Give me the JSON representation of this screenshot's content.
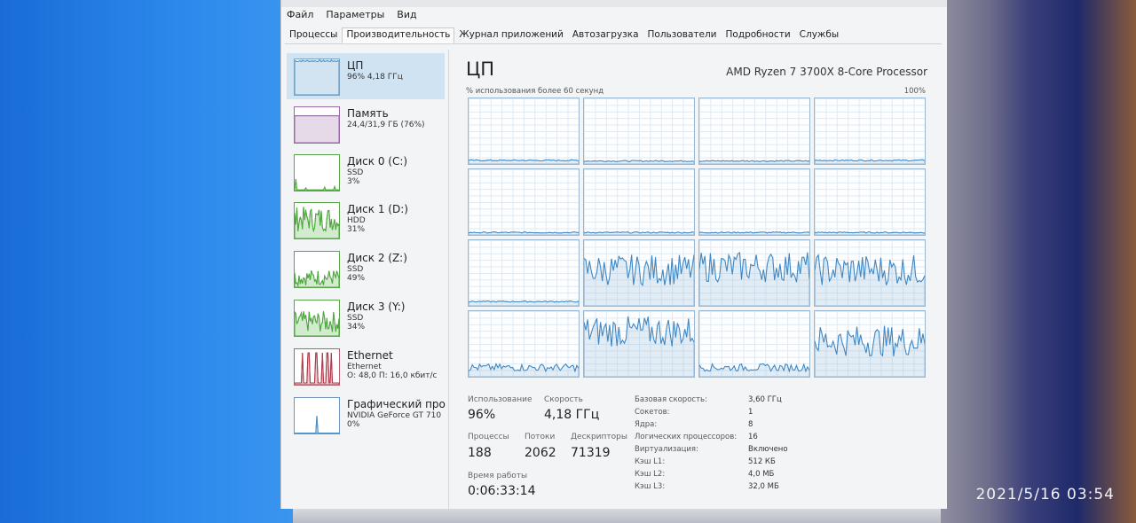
{
  "menu": [
    "Файл",
    "Параметры",
    "Вид"
  ],
  "tabs": [
    {
      "label": "Процессы",
      "active": false
    },
    {
      "label": "Производительность",
      "active": true
    },
    {
      "label": "Журнал приложений",
      "active": false
    },
    {
      "label": "Автозагрузка",
      "active": false
    },
    {
      "label": "Пользователи",
      "active": false
    },
    {
      "label": "Подробности",
      "active": false
    },
    {
      "label": "Службы",
      "active": false
    }
  ],
  "sidebar": [
    {
      "title": "ЦП",
      "line1": "96% 4,18 ГГц",
      "line2": "",
      "kind": "cpu",
      "active": true
    },
    {
      "title": "Память",
      "line1": "24,4/31,9 ГБ (76%)",
      "line2": "",
      "kind": "mem",
      "active": false
    },
    {
      "title": "Диск 0 (C:)",
      "line1": "SSD",
      "line2": "3%",
      "kind": "disk",
      "active": false
    },
    {
      "title": "Диск 1 (D:)",
      "line1": "HDD",
      "line2": "31%",
      "kind": "disk",
      "active": false
    },
    {
      "title": "Диск 2 (Z:)",
      "line1": "SSD",
      "line2": "49%",
      "kind": "disk",
      "active": false
    },
    {
      "title": "Диск 3 (Y:)",
      "line1": "SSD",
      "line2": "34%",
      "kind": "disk",
      "active": false
    },
    {
      "title": "Ethernet",
      "line1": "Ethernet",
      "line2": "О: 48,0 П: 16,0 кбит/с",
      "kind": "eth",
      "active": false
    },
    {
      "title": "Графический про",
      "line1": "NVIDIA GeForce GT 710",
      "line2": "0%",
      "kind": "gpu",
      "active": false
    }
  ],
  "main": {
    "title": "ЦП",
    "processor": "AMD Ryzen 7 3700X 8-Core Processor",
    "graph_caption": "% использования более 60 секунд",
    "graph_max": "100%",
    "core_activity": [
      0.02,
      0.01,
      0.01,
      0.02,
      0.0,
      0.0,
      0.0,
      0.0,
      0.03,
      0.55,
      0.6,
      0.55,
      0.12,
      0.7,
      0.12,
      0.55
    ]
  },
  "stats": {
    "usage_label": "Использование",
    "usage_value": "96%",
    "speed_label": "Скорость",
    "speed_value": "4,18 ГГц",
    "processes_label": "Процессы",
    "processes_value": "188",
    "threads_label": "Потоки",
    "threads_value": "2062",
    "handles_label": "Дескрипторы",
    "handles_value": "71319",
    "uptime_label": "Время работы",
    "uptime_value": "0:06:33:14"
  },
  "details": [
    {
      "label": "Базовая скорость:",
      "value": "3,60 ГГц"
    },
    {
      "label": "Сокетов:",
      "value": "1"
    },
    {
      "label": "Ядра:",
      "value": "8"
    },
    {
      "label": "Логических процессоров:",
      "value": "16"
    },
    {
      "label": "Виртуализация:",
      "value": "Включено"
    },
    {
      "label": "Кэш L1:",
      "value": "512 КБ"
    },
    {
      "label": "Кэш L2:",
      "value": "4,0 МБ"
    },
    {
      "label": "Кэш L3:",
      "value": "32,0 МБ"
    }
  ],
  "timestamp": "2021/5/16  03:54",
  "colors": {
    "cpu": "#4a90c8",
    "mem": "#9b6aa8",
    "disk": "#4caa3c",
    "eth": "#b03a4a",
    "gpu": "#4a90c8"
  }
}
